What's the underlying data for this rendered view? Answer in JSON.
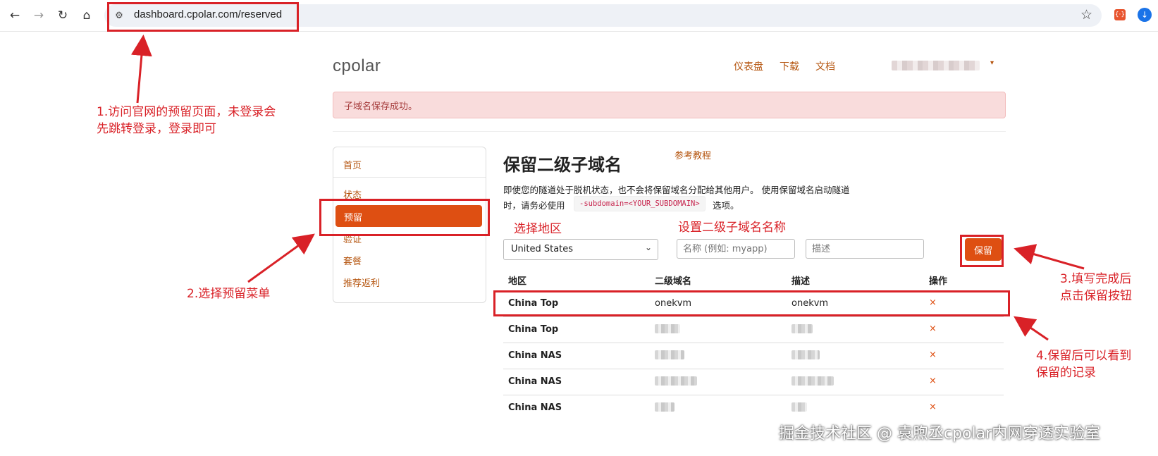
{
  "browser": {
    "url": "dashboard.cpolar.com/reserved",
    "icons": [
      "back-icon",
      "forward-icon",
      "reload-icon",
      "home-icon",
      "site-info-icon",
      "star-icon",
      "extension-icon",
      "download-icon"
    ]
  },
  "header": {
    "brand": "cpolar",
    "nav": [
      "仪表盘",
      "下载",
      "文档"
    ],
    "user_caret": "▾"
  },
  "alert": {
    "message": "子域名保存成功。"
  },
  "sidebar": {
    "items": [
      "首页",
      "状态",
      "预留",
      "验证",
      "套餐",
      "推荐返利"
    ],
    "active": "预留"
  },
  "main": {
    "title": "保留二级子域名",
    "tutorial_link": "参考教程",
    "desc_line1": "即使您的隧道处于脱机状态，也不会将保留域名分配给其他用户。 使用保留域名启动隧道",
    "desc_line2_prefix": "时，请务必使用",
    "desc_code": "-subdomain=<YOUR_SUBDOMAIN>",
    "desc_line2_suffix": "选项。",
    "region_select": "United States",
    "name_placeholder": "名称 (例如: myapp)",
    "desc_placeholder": "描述",
    "save_button": "保留"
  },
  "table": {
    "headers": [
      "地区",
      "二级域名",
      "描述",
      "操作"
    ],
    "rows": [
      {
        "region": "China Top",
        "subdomain": "onekvm",
        "description": "onekvm",
        "action": "×"
      },
      {
        "region": "China Top",
        "subdomain": "",
        "description": "",
        "action": "×"
      },
      {
        "region": "China NAS",
        "subdomain": "",
        "description": "",
        "action": "×"
      },
      {
        "region": "China NAS",
        "subdomain": "",
        "description": "",
        "action": "×"
      },
      {
        "region": "China NAS",
        "subdomain": "",
        "description": "",
        "action": "×"
      }
    ]
  },
  "annotations": {
    "note1_line1": "1.访问官网的预留页面，未登录会",
    "note1_line2": "先跳转登录，登录即可",
    "note2": "2.选择预留菜单",
    "label_region": "选择地区",
    "label_name": "设置二级子域名名称",
    "note3_line1": "3.填写完成后",
    "note3_line2": "点击保留按钮",
    "note4_line1": "4.保留后可以看到",
    "note4_line2": "保留的记录",
    "color": "#d92127"
  },
  "watermark": "掘金技术社区 @ 袁煦丞cpolar内网穿透实验室"
}
